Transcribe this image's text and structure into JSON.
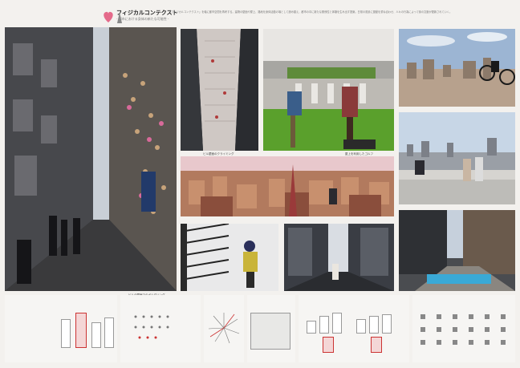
{
  "header": {
    "title": "フィジカルコンテクスト",
    "subtitle": "- 都市における身体の新たな可能性 -",
    "intro": "「フィジカルコンテクスト」を軸に都市空間を再考する。建物の壁面や屋上、路地を身体活動の場として読み替え、都市の中に新たな関係性と体験を生み出す提案。日常の風景に運動を重ね合わせ、人々の行為によって街の文脈が更新されていく。"
  },
  "captions": {
    "p1": "ビルの壁面でのボルダリング",
    "p2": "ビル壁面のクライミング",
    "p3": "屋上を利用したゴルフ",
    "p4": "",
    "p5": "",
    "p6": "",
    "p7": "",
    "p8": "",
    "p9": "",
    "p10": "",
    "p11": ""
  },
  "panels": {
    "d1": {
      "title": "",
      "text": ""
    },
    "d2": {
      "title": "",
      "text": ""
    },
    "d3": {
      "title": "",
      "text": ""
    },
    "d4": {
      "title": "",
      "text": ""
    },
    "d5": {
      "title": "",
      "text": ""
    },
    "d6": {
      "title": "",
      "text": ""
    }
  },
  "colors": {
    "accent": "#e46a8a",
    "sky": "#b9c9da",
    "grass": "#5aa02c",
    "brick": "#b46a50"
  }
}
